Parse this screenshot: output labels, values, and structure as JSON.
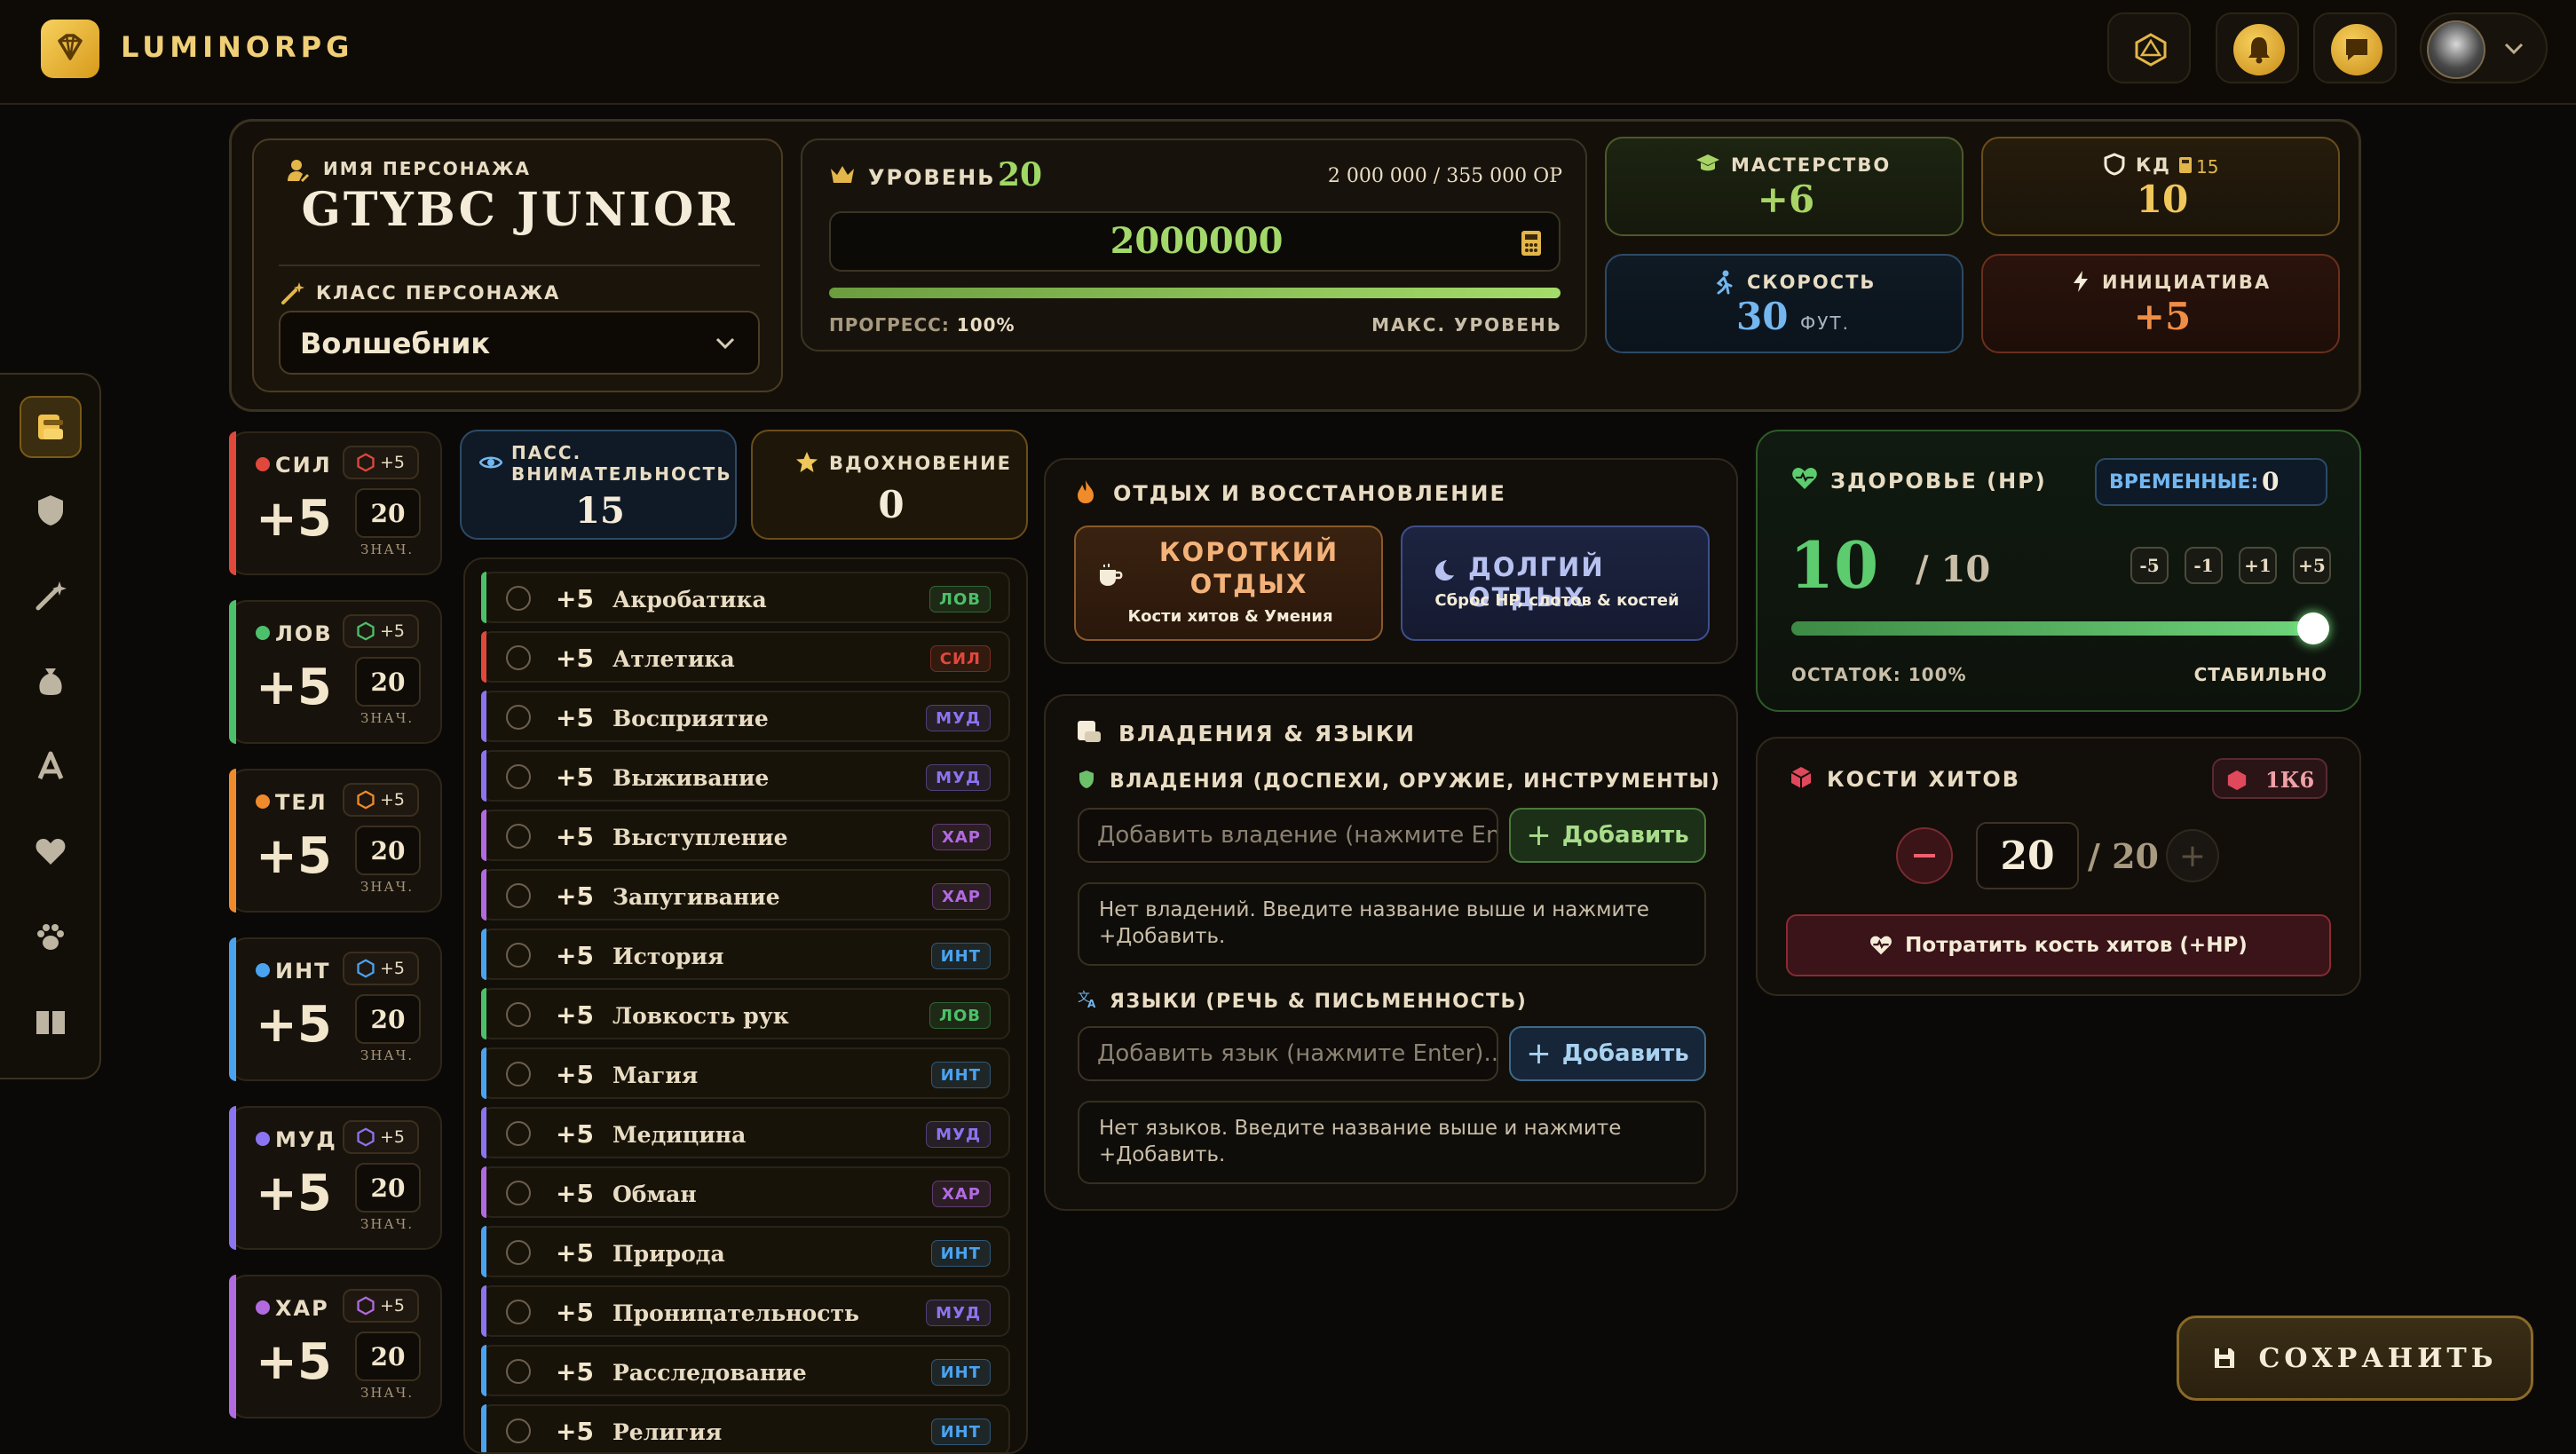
{
  "app": {
    "name": "LUMINORPG"
  },
  "topbar": {
    "icons": [
      "d20-icon",
      "bell-icon",
      "chat-icon",
      "avatar",
      "chevron-down-icon"
    ]
  },
  "character": {
    "name_label": "ИМЯ ПЕРСОНАЖА",
    "name": "GTYBC JUNIOR",
    "class_label": "КЛАСС ПЕРСОНАЖА",
    "class_value": "Волшебник"
  },
  "level": {
    "label": "УРОВЕНЬ",
    "value": "20",
    "xp_text": "2 000 000 / 355 000 ОР",
    "xp_input": "2000000",
    "progress_label": "ПРОГРЕСС:",
    "progress_value": "100%",
    "progress_fraction": 1.0,
    "max_label": "МАКС. УРОВЕНЬ"
  },
  "stats": {
    "mastery": {
      "label": "МАСТЕРСТВО",
      "value": "+6"
    },
    "ac": {
      "label": "КД",
      "armor_value": "15",
      "value": "10"
    },
    "speed": {
      "label": "СКОРОСТЬ",
      "value": "30",
      "unit": "ФУТ."
    },
    "initiative": {
      "label": "ИНИЦИАТИВА",
      "value": "+5"
    }
  },
  "abilities": [
    {
      "short": "СИЛ",
      "save": "+5",
      "mod": "+5",
      "score": "20",
      "score_label": "ЗНАЧ.",
      "color": "#e0483c"
    },
    {
      "short": "ЛОВ",
      "save": "+5",
      "mod": "+5",
      "score": "20",
      "score_label": "ЗНАЧ.",
      "color": "#4cc06a"
    },
    {
      "short": "ТЕЛ",
      "save": "+5",
      "mod": "+5",
      "score": "20",
      "score_label": "ЗНАЧ.",
      "color": "#f08b2c"
    },
    {
      "short": "ИНТ",
      "save": "+5",
      "mod": "+5",
      "score": "20",
      "score_label": "ЗНАЧ.",
      "color": "#4aa3f0"
    },
    {
      "short": "МУД",
      "save": "+5",
      "mod": "+5",
      "score": "20",
      "score_label": "ЗНАЧ.",
      "color": "#8b74f0"
    },
    {
      "short": "ХАР",
      "save": "+5",
      "mod": "+5",
      "score": "20",
      "score_label": "ЗНАЧ.",
      "color": "#b26ae0"
    }
  ],
  "passive": {
    "label": "ПАСС. ВНИМАТЕЛЬНОСТЬ",
    "value": "15"
  },
  "inspiration": {
    "label": "ВДОХНОВЕНИЕ",
    "value": "0"
  },
  "skills": [
    {
      "value": "+5",
      "name": "Акробатика",
      "tag": "ЛОВ"
    },
    {
      "value": "+5",
      "name": "Атлетика",
      "tag": "СИЛ"
    },
    {
      "value": "+5",
      "name": "Восприятие",
      "tag": "МУД"
    },
    {
      "value": "+5",
      "name": "Выживание",
      "tag": "МУД"
    },
    {
      "value": "+5",
      "name": "Выступление",
      "tag": "ХАР"
    },
    {
      "value": "+5",
      "name": "Запугивание",
      "tag": "ХАР"
    },
    {
      "value": "+5",
      "name": "История",
      "tag": "ИНТ"
    },
    {
      "value": "+5",
      "name": "Ловкость рук",
      "tag": "ЛОВ"
    },
    {
      "value": "+5",
      "name": "Магия",
      "tag": "ИНТ"
    },
    {
      "value": "+5",
      "name": "Медицина",
      "tag": "МУД"
    },
    {
      "value": "+5",
      "name": "Обман",
      "tag": "ХАР"
    },
    {
      "value": "+5",
      "name": "Природа",
      "tag": "ИНТ"
    },
    {
      "value": "+5",
      "name": "Проницательность",
      "tag": "МУД"
    },
    {
      "value": "+5",
      "name": "Расследование",
      "tag": "ИНТ"
    },
    {
      "value": "+5",
      "name": "Религия",
      "tag": "ИНТ"
    }
  ],
  "tag_colors": {
    "ЛОВ": "#4cc06a",
    "СИЛ": "#e0483c",
    "МУД": "#8b74f0",
    "ХАР": "#b26ae0",
    "ИНТ": "#4aa3f0"
  },
  "rest": {
    "title": "ОТДЫХ И ВОССТАНОВЛЕНИЕ",
    "short_title": "КОРОТКИЙ ОТДЫХ",
    "short_sub": "Кости хитов & Умения",
    "long_title": "ДОЛГИЙ ОТДЫХ",
    "long_sub": "Сброс HP, слотов & костей"
  },
  "proficiency": {
    "title": "ВЛАДЕНИЯ & ЯЗЫКИ",
    "own_label": "ВЛАДЕНИЯ (ДОСПЕХИ, ОРУЖИЕ, ИНСТРУМЕНТЫ)",
    "own_placeholder": "Добавить владение (нажмите En",
    "add_label": "Добавить",
    "own_empty": "Нет владений. Введите название выше и нажмите +Добавить.",
    "lang_label": "ЯЗЫКИ (РЕЧЬ & ПИСЬМЕННОСТЬ)",
    "lang_placeholder": "Добавить язык (нажмите Enter)...",
    "lang_empty": "Нет языков. Введите название выше и нажмите +Добавить."
  },
  "health": {
    "title": "ЗДОРОВЬЕ (HP)",
    "temp_label": "ВРЕМЕННЫЕ:",
    "temp_value": "0",
    "current": "10",
    "max": "/ 10",
    "buttons": [
      "-5",
      "-1",
      "+1",
      "+5"
    ],
    "fraction": 1.0,
    "remain_label": "ОСТАТОК: 100%",
    "status": "СТАБИЛЬНО"
  },
  "hit_dice": {
    "title": "КОСТИ ХИТОВ",
    "die": "1К6",
    "current": "20",
    "max": "/ 20",
    "spend_label": "Потратить кость хитов (+HP)"
  },
  "save": {
    "label": "СОХРАНИТЬ"
  }
}
